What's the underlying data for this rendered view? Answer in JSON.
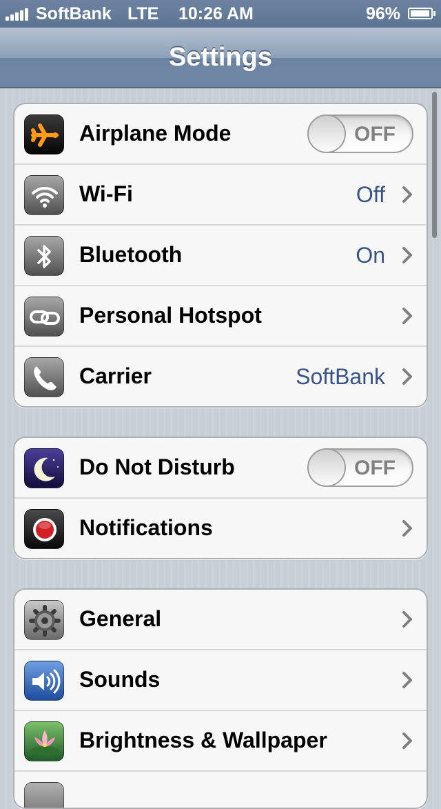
{
  "status_bar": {
    "carrier": "SoftBank",
    "network": "LTE",
    "time": "10:26 AM",
    "battery": "96%",
    "battery_level": 0.96,
    "signal_bars": 5
  },
  "nav_bar": {
    "title": "Settings"
  },
  "groups": [
    {
      "rows": [
        {
          "label": "Airplane Mode",
          "control": "toggle",
          "toggle": "OFF",
          "icon": "airplane-icon"
        },
        {
          "label": "Wi-Fi",
          "value": "Off",
          "icon": "wifi-icon"
        },
        {
          "label": "Bluetooth",
          "value": "On",
          "icon": "bluetooth-icon"
        },
        {
          "label": "Personal Hotspot",
          "value": "",
          "icon": "hotspot-icon"
        },
        {
          "label": "Carrier",
          "value": "SoftBank",
          "icon": "phone-icon"
        }
      ]
    },
    {
      "rows": [
        {
          "label": "Do Not Disturb",
          "control": "toggle",
          "toggle": "OFF",
          "icon": "moon-icon"
        },
        {
          "label": "Notifications",
          "value": "",
          "icon": "notifications-icon"
        }
      ]
    },
    {
      "rows": [
        {
          "label": "General",
          "value": "",
          "icon": "gear-icon"
        },
        {
          "label": "Sounds",
          "value": "",
          "icon": "speaker-icon"
        },
        {
          "label": "Brightness & Wallpaper",
          "value": "",
          "icon": "flower-icon"
        }
      ]
    }
  ],
  "colors": {
    "value_text": "#385487",
    "nav_bar": "#6f86a4",
    "background": "#c5ccd4"
  }
}
